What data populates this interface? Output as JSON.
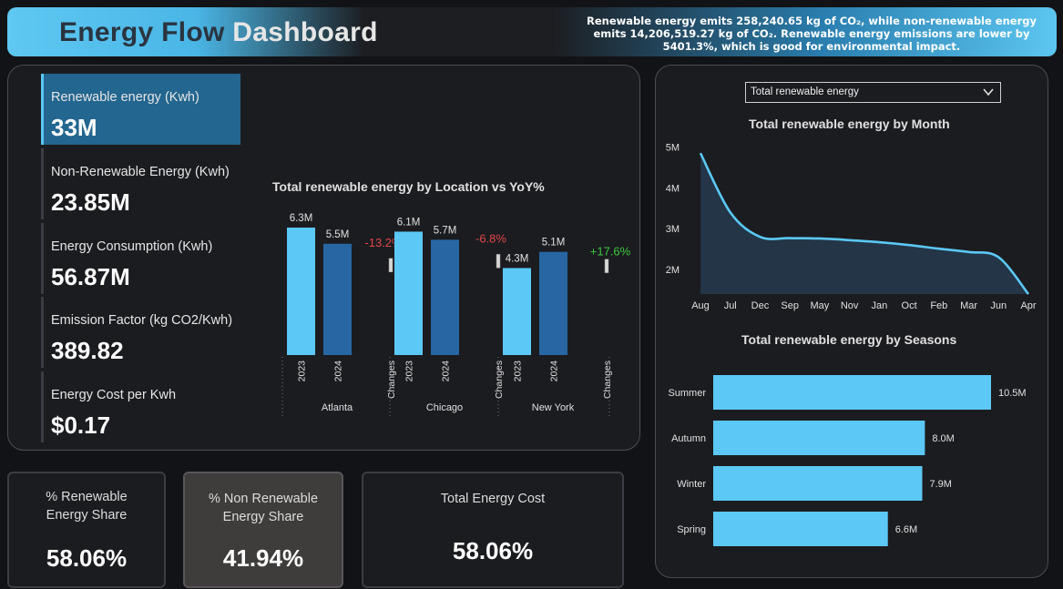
{
  "header": {
    "title_part1": "Energy Flow ",
    "title_part2": "Dashboard",
    "note": "Renewable energy emits 258,240.65 kg of CO₂, while non-renewable energy emits 14,206,519.27 kg of CO₂. Renewable energy emissions are lower by 5401.3%, which is good for environmental impact."
  },
  "kpis": [
    {
      "label": "Renewable energy (Kwh)",
      "value": "33M",
      "active": true
    },
    {
      "label": "Non-Renewable Energy (Kwh)",
      "value": "23.85M",
      "active": false
    },
    {
      "label": "Energy Consumption (Kwh)",
      "value": "56.87M",
      "active": false
    },
    {
      "label": "Emission Factor (kg CO2/Kwh)",
      "value": "389.82",
      "active": false
    },
    {
      "label": "Energy Cost per Kwh",
      "value": "$0.17",
      "active": false
    }
  ],
  "cards": [
    {
      "label": "% Renewable Energy Share",
      "value": "58.06%"
    },
    {
      "label": "% Non Renewable Energy Share",
      "value": "41.94%"
    },
    {
      "label": "Total Energy Cost",
      "value": "58.06%"
    }
  ],
  "dropdown": {
    "selected": "Total renewable energy"
  },
  "colors": {
    "light_blue": "#5bc8f5",
    "dark_blue": "#2766a3",
    "negative": "#e04848",
    "positive": "#3cc83c"
  },
  "chart_data": [
    {
      "type": "bar",
      "title": "Total renewable energy by Location vs YoY%",
      "groups": [
        "Atlanta",
        "Chicago",
        "New York"
      ],
      "categories": [
        "2023",
        "2024",
        "Changes"
      ],
      "series": [
        {
          "name": "2023",
          "values": [
            6.3,
            6.1,
            4.3
          ],
          "labels": [
            "6.3M",
            "6.1M",
            "4.3M"
          ]
        },
        {
          "name": "2024",
          "values": [
            5.5,
            5.7,
            5.1
          ],
          "labels": [
            "5.5M",
            "5.7M",
            "5.1M"
          ]
        }
      ],
      "changes": [
        "-13.2%",
        "-6.8%",
        "+17.6%"
      ],
      "ylim": [
        0,
        7
      ]
    },
    {
      "type": "area",
      "title": "Total renewable energy by Month",
      "x": [
        "Aug",
        "Jul",
        "Dec",
        "Sep",
        "May",
        "Nov",
        "Jan",
        "Oct",
        "Feb",
        "Mar",
        "Jun",
        "Apr"
      ],
      "y": [
        4.85,
        3.4,
        2.8,
        2.77,
        2.76,
        2.72,
        2.67,
        2.6,
        2.51,
        2.43,
        2.3,
        1.4
      ],
      "yticks": [
        "2M",
        "3M",
        "4M",
        "5M"
      ],
      "ylim": [
        1.4,
        5.1
      ]
    },
    {
      "type": "bar",
      "orientation": "horizontal",
      "title": "Total renewable energy by Seasons",
      "categories": [
        "Summer",
        "Autumn",
        "Winter",
        "Spring"
      ],
      "values": [
        10.5,
        8.0,
        7.9,
        6.6
      ],
      "labels": [
        "10.5M",
        "8.0M",
        "7.9M",
        "6.6M"
      ],
      "xlim": [
        0,
        10.5
      ]
    }
  ]
}
